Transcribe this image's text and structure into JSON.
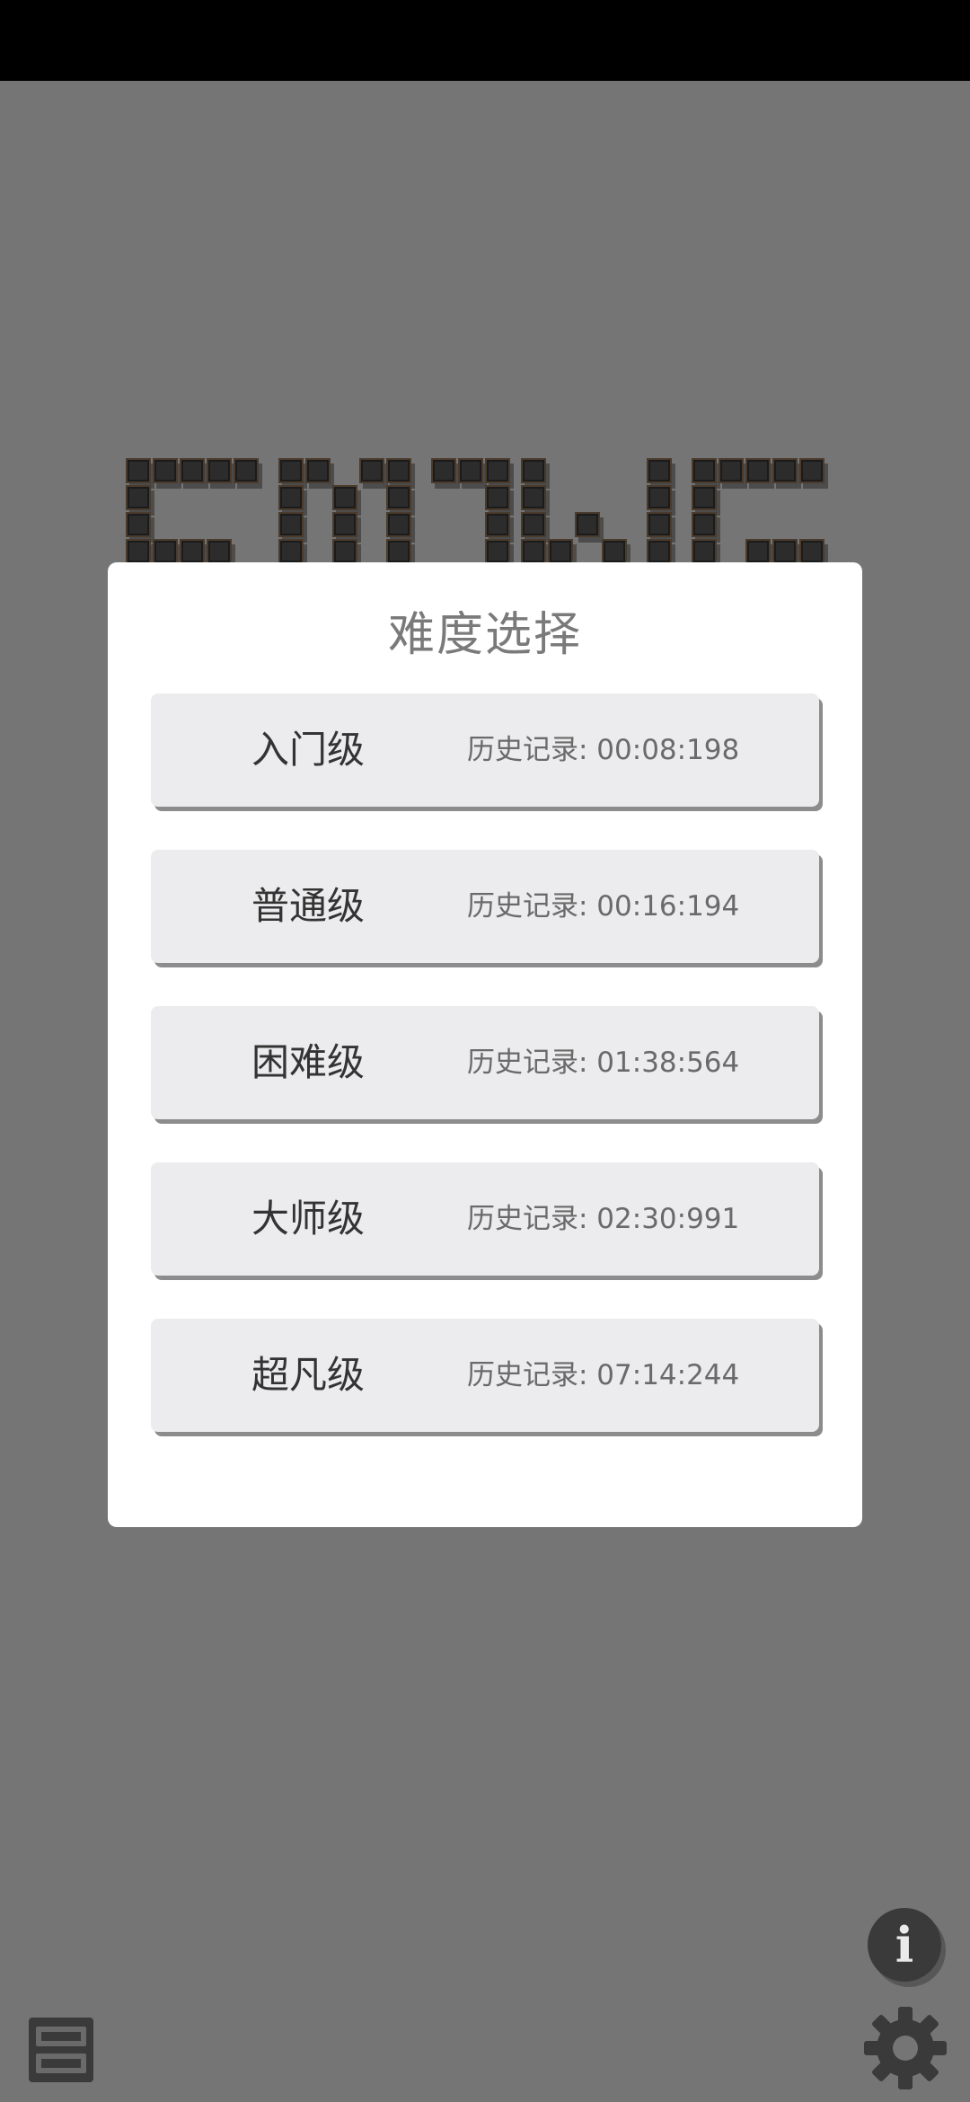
{
  "dialog": {
    "title": "难度选择",
    "levels": [
      {
        "name": "入门级",
        "record": "历史记录: 00:08:198"
      },
      {
        "name": "普通级",
        "record": "历史记录: 00:16:194"
      },
      {
        "name": "困难级",
        "record": "历史记录: 01:38:564"
      },
      {
        "name": "大师级",
        "record": "历史记录: 02:30:991"
      },
      {
        "name": "超凡级",
        "record": "历史记录: 07:14:244"
      }
    ]
  },
  "logo": {
    "icon": "block-logo"
  },
  "controls": {
    "info_icon": "info-icon",
    "info_glyph": "i",
    "settings_icon": "gear-icon",
    "records_icon": "records-icon"
  },
  "colors": {
    "background": "#757575",
    "dialog": "#ffffff",
    "button": "#ececee",
    "title_text": "#7a7a7a"
  }
}
